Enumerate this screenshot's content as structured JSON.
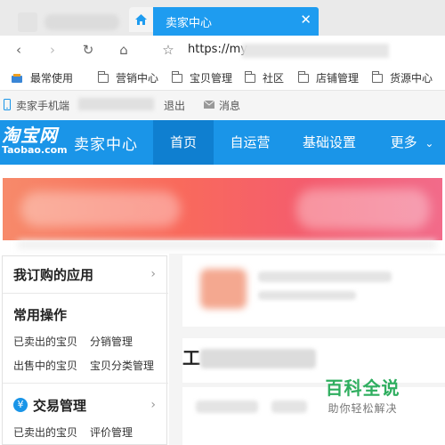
{
  "browser": {
    "active_tab_title": "卖家中心",
    "close_glyph": "✕",
    "url_prefix": "https://my",
    "nav": {
      "back": "‹",
      "forward": "›",
      "reload": "↻",
      "home": "⌂",
      "bookmark_star": "☆"
    },
    "bookmarks": [
      {
        "label": "最常使用",
        "icon": "bookmarks-icon"
      },
      {
        "label": "营销中心",
        "icon": "folder-icon"
      },
      {
        "label": "宝贝管理",
        "icon": "folder-icon"
      },
      {
        "label": "社区",
        "icon": "folder-icon"
      },
      {
        "label": "店铺管理",
        "icon": "folder-icon"
      },
      {
        "label": "货源中心",
        "icon": "folder-icon"
      }
    ]
  },
  "infobar": {
    "mobile_label": "卖家手机端",
    "logout_label": "退出",
    "messages_label": "消息"
  },
  "header": {
    "logo_cn": "淘宝网",
    "logo_en": "Taobao.com",
    "seller_center": "卖家中心",
    "nav": [
      {
        "label": "首页",
        "active": true
      },
      {
        "label": "自运营",
        "active": false
      },
      {
        "label": "基础设置",
        "active": false
      },
      {
        "label": "更多",
        "active": false
      }
    ],
    "more_chevron": "⌄",
    "accent_color": "#1a95e8"
  },
  "sidebar": {
    "subscribed_apps_title": "我订购的应用",
    "chevron": "›",
    "common_ops_title": "常用操作",
    "common_ops_links": [
      "已卖出的宝贝",
      "分销管理",
      "出售中的宝贝",
      "宝贝分类管理"
    ],
    "trade_title": "交易管理",
    "trade_icon_glyph": "¥",
    "trade_links": [
      "已卖出的宝贝",
      "评价管理"
    ]
  },
  "main": {
    "section_glyph": "工"
  },
  "watermark": {
    "main": "百科全说",
    "sub": "助你轻松解决"
  }
}
